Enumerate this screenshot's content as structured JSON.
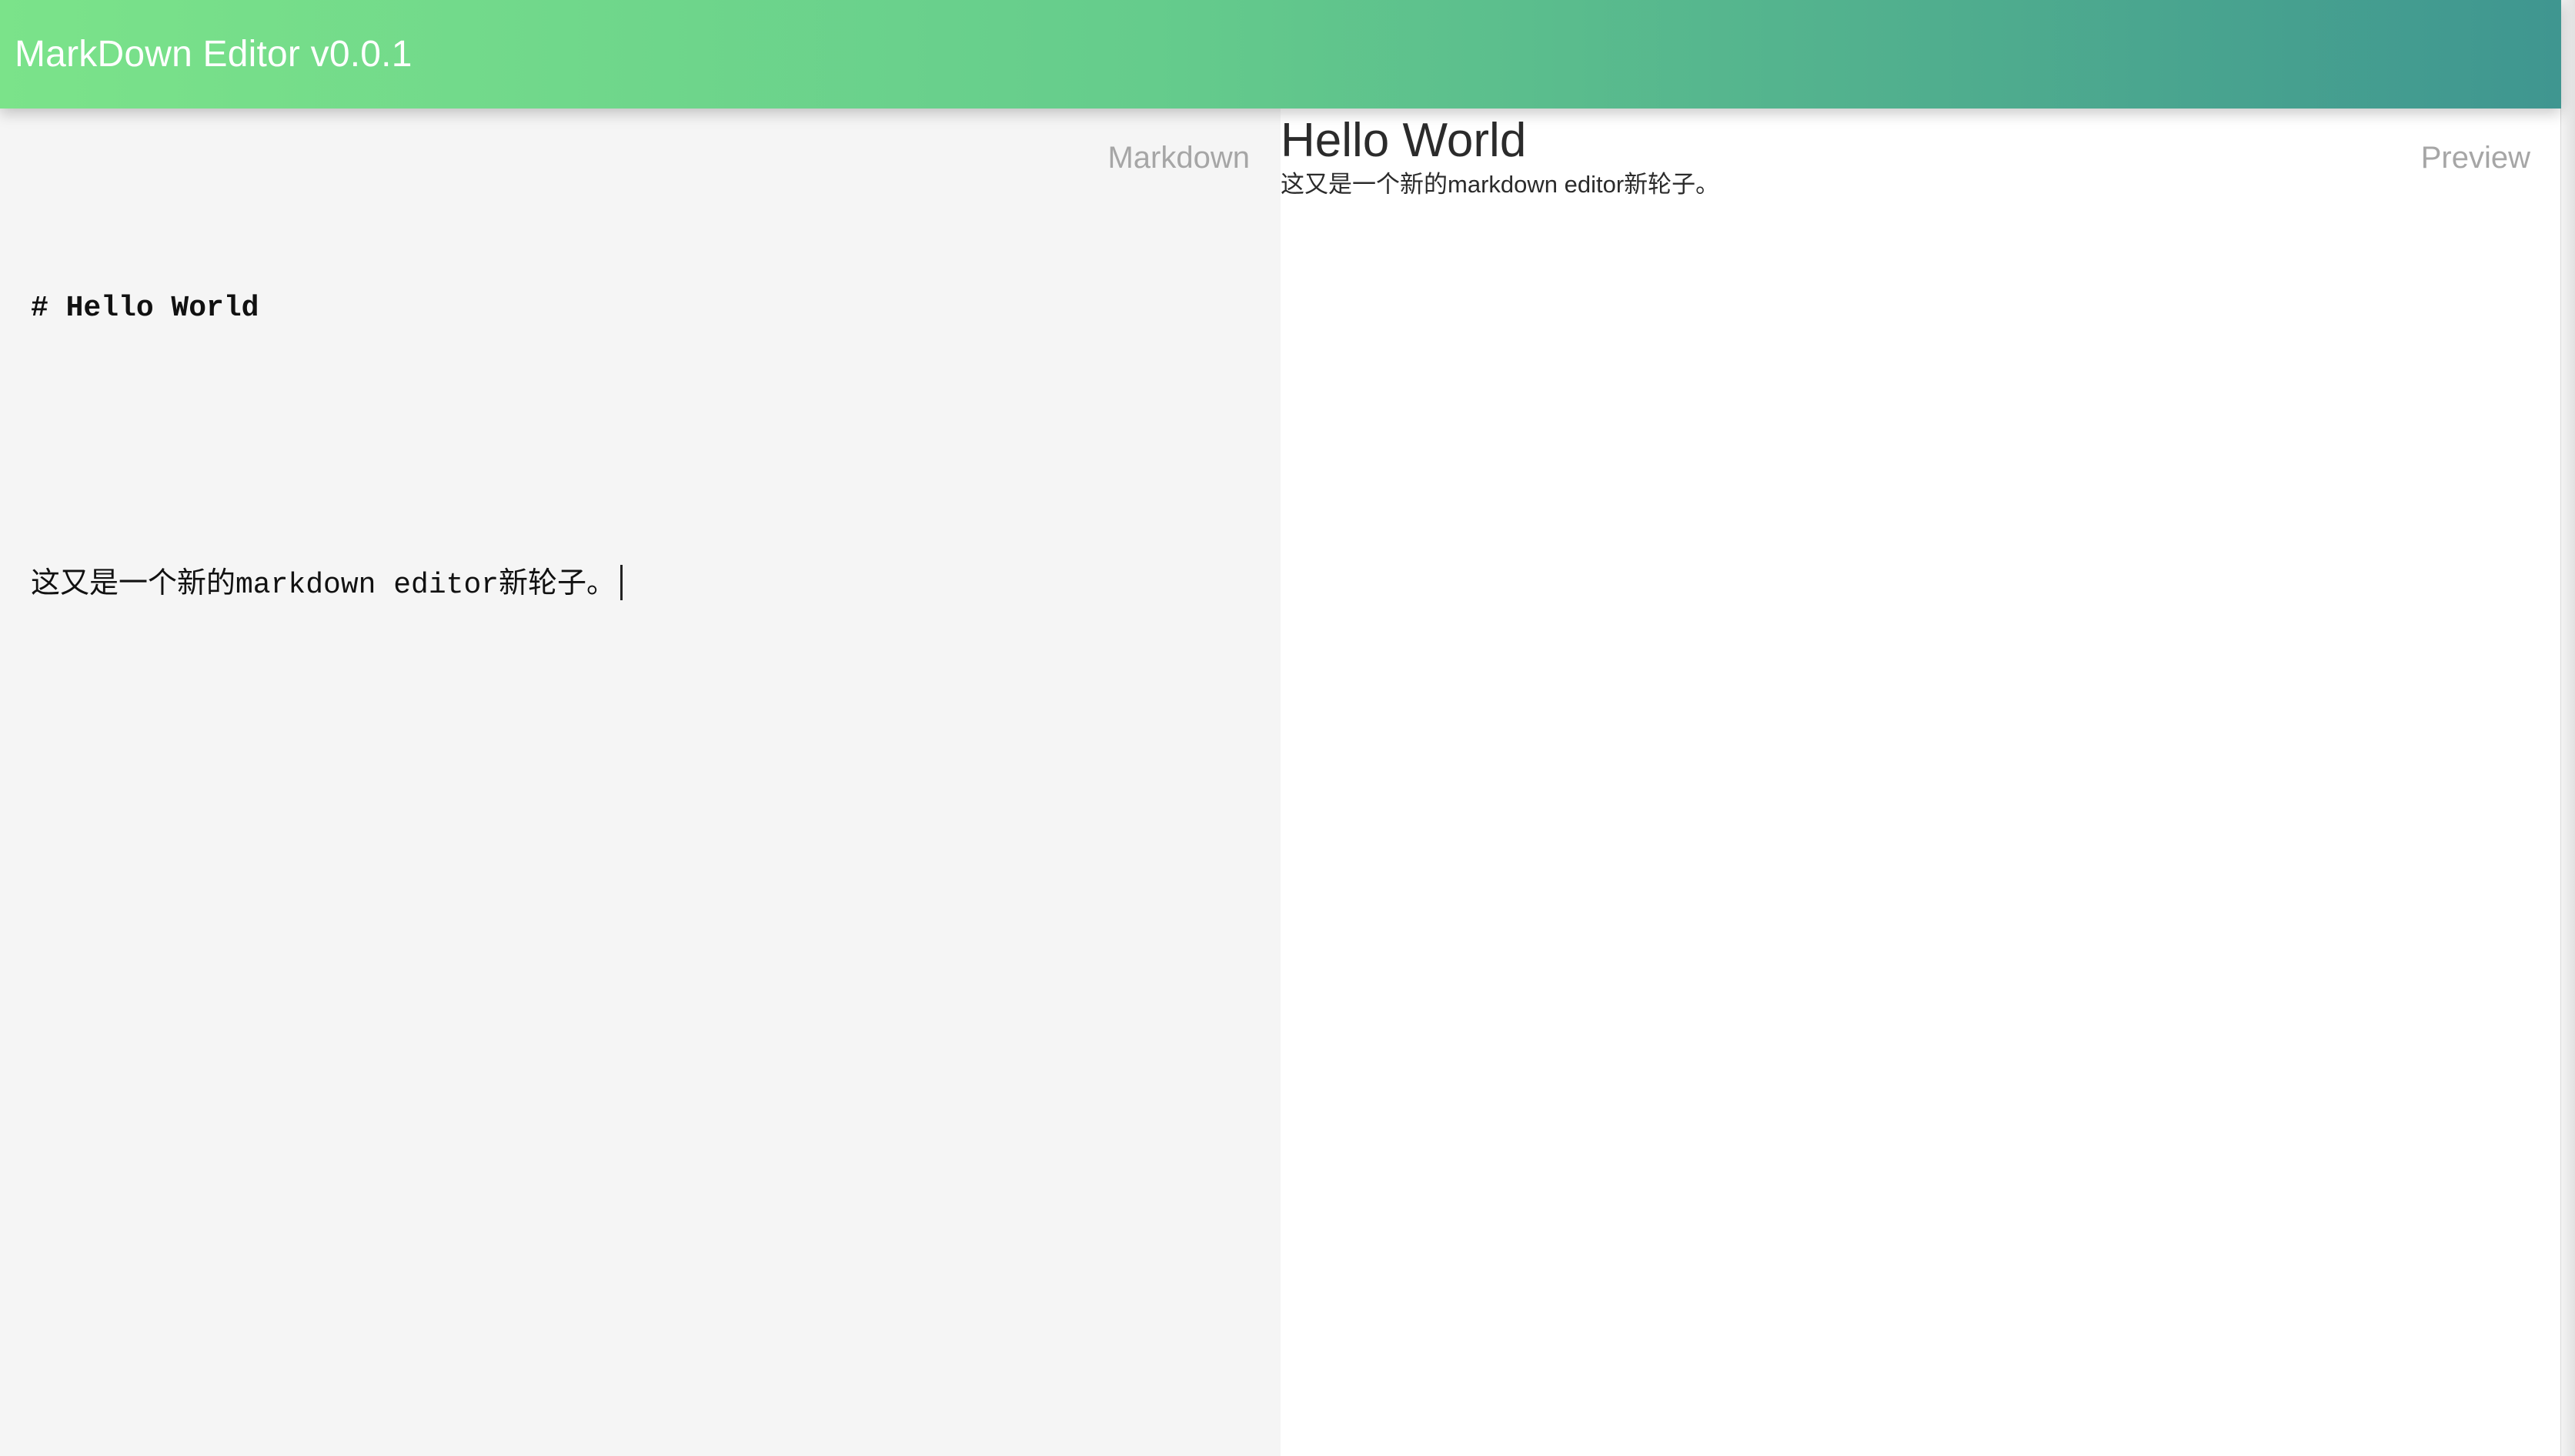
{
  "header": {
    "title": "MarkDown Editor v0.0.1"
  },
  "editor": {
    "label": "Markdown",
    "lines": [
      "# Hello World",
      "",
      "这又是一个新的markdown editor新轮子。"
    ]
  },
  "preview": {
    "label": "Preview",
    "heading": "Hello World",
    "paragraph": "这又是一个新的markdown editor新轮子。"
  },
  "colors": {
    "header_gradient_start": "#7be38a",
    "header_gradient_end": "#3f9690",
    "editor_background": "#f5f5f5",
    "preview_background": "#ffffff",
    "label_color": "#a6a6a6"
  }
}
